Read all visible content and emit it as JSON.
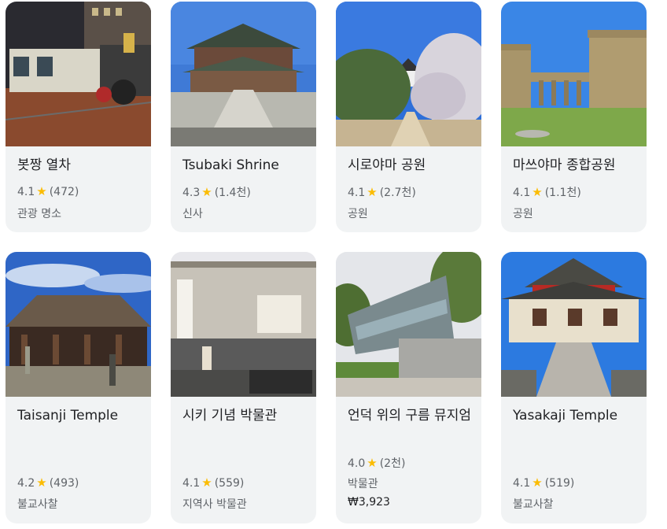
{
  "cards": [
    {
      "title": "봇짱 열차",
      "rating": "4.1",
      "reviews": "(472)",
      "category": "관광 명소"
    },
    {
      "title": "Tsubaki Shrine",
      "rating": "4.3",
      "reviews": "(1.4천)",
      "category": "신사"
    },
    {
      "title": "시로야마 공원",
      "rating": "4.1",
      "reviews": "(2.7천)",
      "category": "공원"
    },
    {
      "title": "마쓰야마 종합공원",
      "rating": "4.1",
      "reviews": "(1.1천)",
      "category": "공원"
    },
    {
      "title": "Taisanji Temple",
      "rating": "4.2",
      "reviews": "(493)",
      "category": "불교사찰"
    },
    {
      "title": "시키 기념 박물관",
      "rating": "4.1",
      "reviews": "(559)",
      "category": "지역사 박물관"
    },
    {
      "title": "언덕 위의 구름 뮤지엄",
      "rating": "4.0",
      "reviews": "(2천)",
      "category": "박물관",
      "price": "₩3,923"
    },
    {
      "title": "Yasakaji Temple",
      "rating": "4.1",
      "reviews": "(519)",
      "category": "불교사찰"
    }
  ],
  "star_glyph": "★",
  "star_color": "#fbbc04"
}
